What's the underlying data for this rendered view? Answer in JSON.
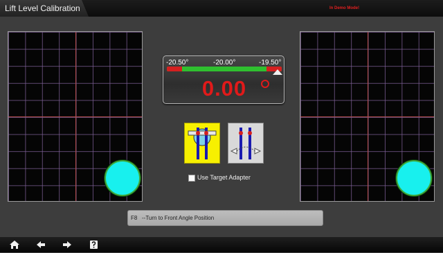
{
  "window": {
    "title": "Lift Level Calibration",
    "demo_mode": "In Demo Mode!"
  },
  "gauge": {
    "min_label": "-20.50°",
    "mid_label": "-20.00°",
    "max_label": "-19.50°",
    "value": "0.00"
  },
  "options": {
    "use_target_adapter": "Use Target Adapter"
  },
  "status": {
    "key": "F8",
    "message": "--Turn to Front Angle Position"
  },
  "nav": {
    "icons": [
      "home-icon",
      "back-arrow-icon",
      "forward-arrow-icon",
      "help-icon"
    ]
  },
  "colors": {
    "target": "#18f0ee",
    "value_red": "#e01a1a",
    "bar_green": "#2fbf2f",
    "adapter_selected": "#f7f000"
  }
}
